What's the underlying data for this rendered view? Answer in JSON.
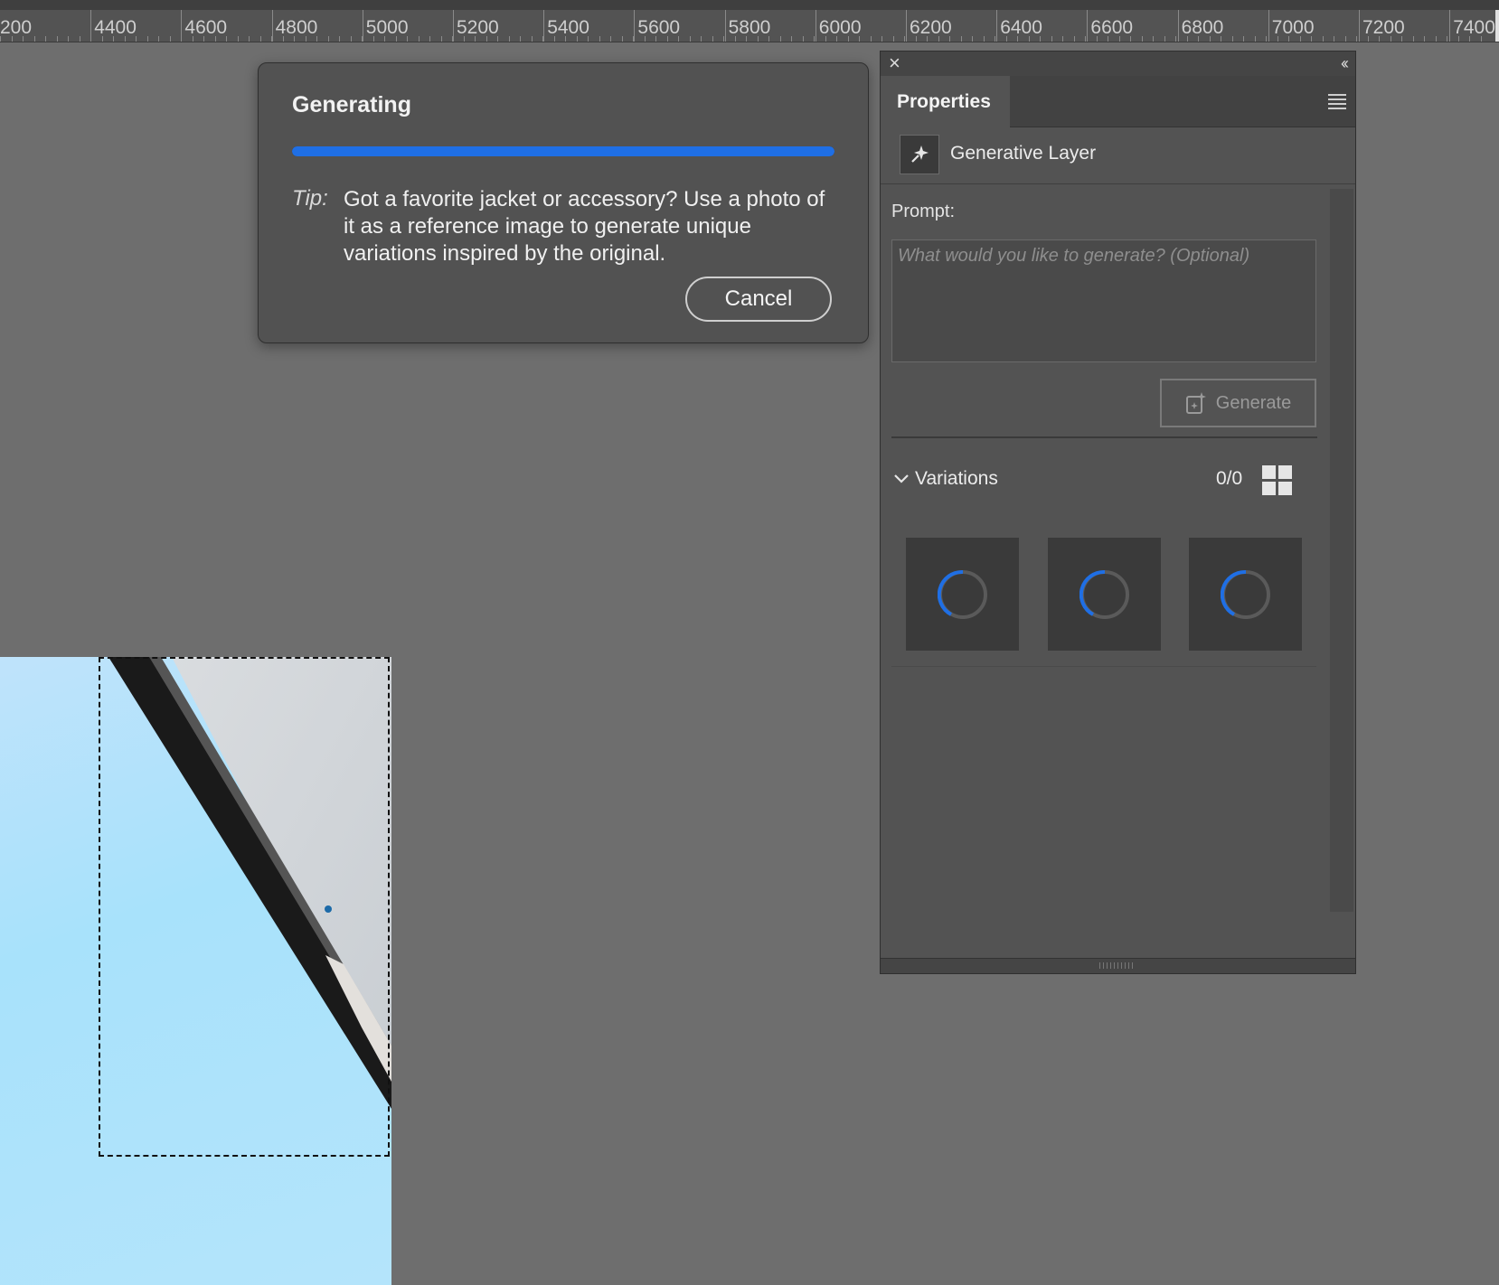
{
  "ruler": {
    "labels": [
      "200",
      "4400",
      "4600",
      "4800",
      "5000",
      "5200",
      "5400",
      "5600",
      "5800",
      "6000",
      "6200",
      "6400",
      "6600",
      "6800",
      "7000",
      "7200",
      "7400"
    ]
  },
  "dialog": {
    "title": "Generating",
    "progress_percent": 100,
    "tip_label": "Tip:",
    "tip_text": "Got a favorite jacket or accessory? Use a photo of it as a reference image to generate unique variations inspired by the original.",
    "cancel_label": "Cancel"
  },
  "panel": {
    "close_icon": "×",
    "collapse_icon": "‹‹",
    "tab_label": "Properties",
    "layer_name": "Generative Layer",
    "prompt_label": "Prompt:",
    "prompt_value": "",
    "prompt_placeholder": "What would you like to generate? (Optional)",
    "generate_label": "Generate",
    "variations_label": "Variations",
    "variations_count": "0/0",
    "variation_thumbnails": 3
  },
  "colors": {
    "accent": "#1f6fe5",
    "panel_bg": "#535353",
    "workspace_bg": "#6e6e6e"
  }
}
